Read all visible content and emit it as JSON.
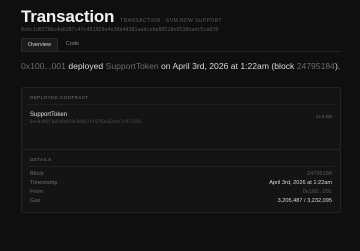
{
  "header": {
    "title": "Transaction",
    "subtitle": "TRANSACTION · EVM.NOW SUPPORT",
    "hash": "0xbc1d8376bc4ab287c4fc451929e4e30d44381aadcebe88528e9538badc5ca878"
  },
  "tabs": [
    {
      "label": "Overview",
      "active": true
    },
    {
      "label": "Code",
      "active": false
    }
  ],
  "summary": {
    "from": "0x100...001",
    "action": "deployed",
    "contract": "SupportToken",
    "on": "on",
    "date": "April 3rd, 2026 at 1:22am",
    "block_prefix": "(block",
    "block": "24795184",
    "block_suffix": ")."
  },
  "deployed": {
    "label": "DEPLOYED CONTRACT",
    "name": "SupportToken",
    "address": "0xeda96f1b6d4a929c0d667cf4793e42edf7c971193",
    "size": "12.6 KB"
  },
  "details": {
    "label": "DETAILS",
    "rows": [
      {
        "label": "Block",
        "value": "24795184",
        "dim": true
      },
      {
        "label": "Timestamp",
        "value": "April 3rd, 2026 at 1:22am",
        "dim": false
      },
      {
        "label": "From",
        "value": "0x100...001",
        "dim": true
      },
      {
        "label": "Gas",
        "value": "3,205,487 / 3,232,095",
        "dim": false
      }
    ]
  }
}
